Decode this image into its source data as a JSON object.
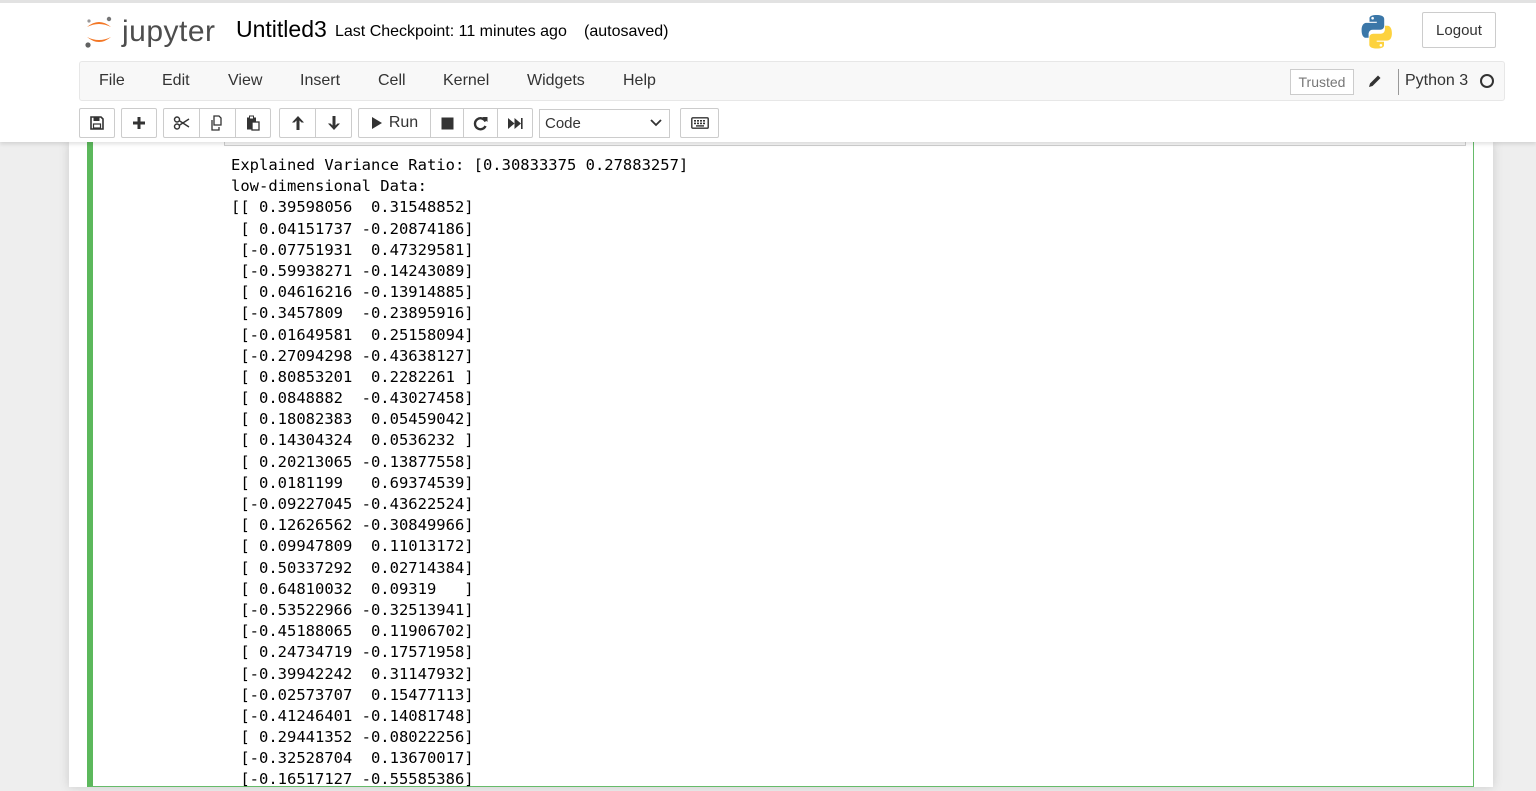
{
  "header": {
    "logo_text": "jupyter",
    "notebook_name": "Untitled3",
    "checkpoint": "Last Checkpoint: 11 minutes ago",
    "autosave_status": "(autosaved)",
    "logout_label": "Logout"
  },
  "menu": {
    "items": [
      "File",
      "Edit",
      "View",
      "Insert",
      "Cell",
      "Kernel",
      "Widgets",
      "Help"
    ],
    "trusted_label": "Trusted",
    "kernel_name": "Python 3"
  },
  "toolbar": {
    "run_label": "Run",
    "cell_type": "Code"
  },
  "colors": {
    "cell_border": "#5cb85c",
    "jupyter_orange": "#f37726"
  },
  "output": {
    "lines": [
      "Explained Variance Ratio: [0.30833375 0.27883257]",
      "low-dimensional Data:",
      "[[ 0.39598056  0.31548852]",
      " [ 0.04151737 -0.20874186]",
      " [-0.07751931  0.47329581]",
      " [-0.59938271 -0.14243089]",
      " [ 0.04616216 -0.13914885]",
      " [-0.3457809  -0.23895916]",
      " [-0.01649581  0.25158094]",
      " [-0.27094298 -0.43638127]",
      " [ 0.80853201  0.2282261 ]",
      " [ 0.0848882  -0.43027458]",
      " [ 0.18082383  0.05459042]",
      " [ 0.14304324  0.0536232 ]",
      " [ 0.20213065 -0.13877558]",
      " [ 0.0181199   0.69374539]",
      " [-0.09227045 -0.43622524]",
      " [ 0.12626562 -0.30849966]",
      " [ 0.09947809  0.11013172]",
      " [ 0.50337292  0.02714384]",
      " [ 0.64810032  0.09319   ]",
      " [-0.53522966 -0.32513941]",
      " [-0.45188065  0.11906702]",
      " [ 0.24734719 -0.17571958]",
      " [-0.39942242  0.31147932]",
      " [-0.02573707  0.15477113]",
      " [-0.41246401 -0.14081748]",
      " [ 0.29441352 -0.08022256]",
      " [-0.32528704  0.13670017]",
      " [-0.16517127 -0.55585386]"
    ]
  }
}
